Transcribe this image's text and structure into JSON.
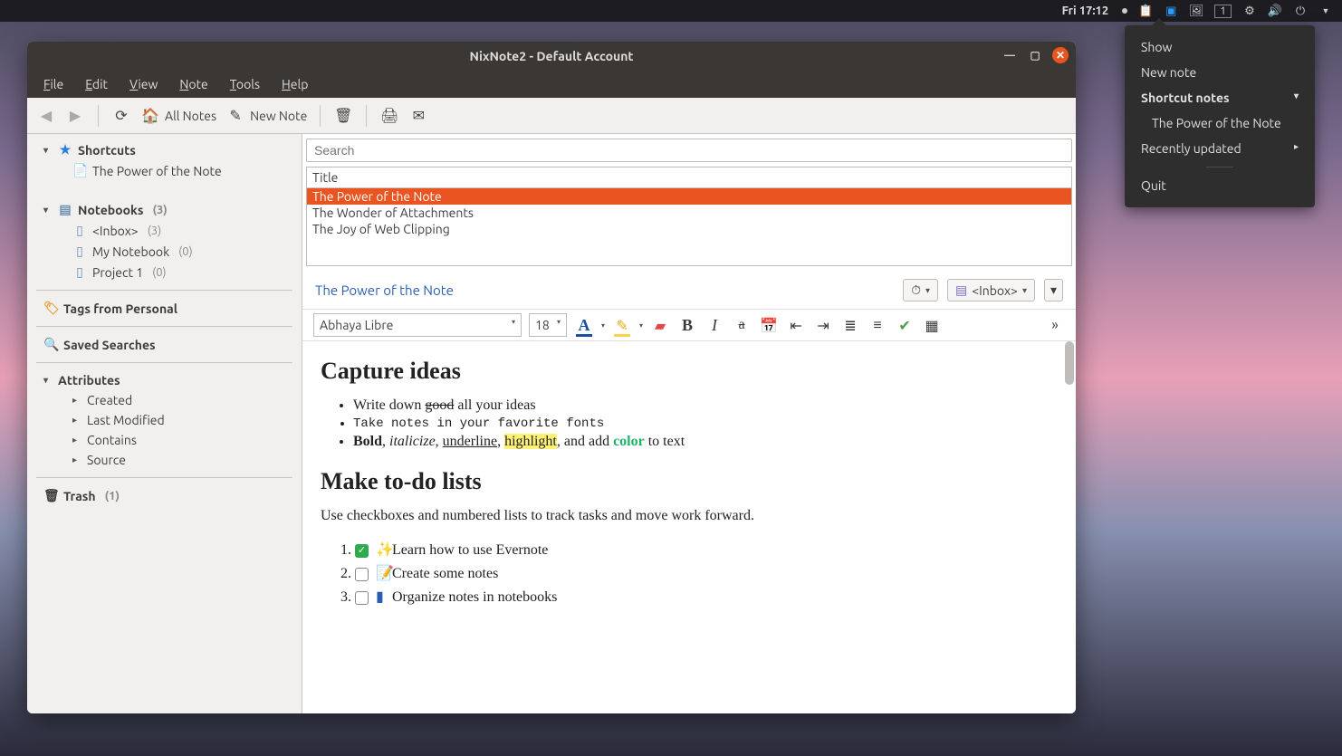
{
  "topbar": {
    "clock": "Fri 17:12",
    "workspace": "1"
  },
  "tray_menu": {
    "show": "Show",
    "new_note": "New note",
    "shortcut_notes": "Shortcut notes",
    "shortcut_link": "The Power of the Note",
    "recently_updated": "Recently updated",
    "quit": "Quit"
  },
  "window": {
    "title": "NixNote2 - Default Account"
  },
  "menubar": {
    "file": "File",
    "edit": "Edit",
    "view": "View",
    "note": "Note",
    "tools": "Tools",
    "help": "Help"
  },
  "toolbar": {
    "all_notes": "All Notes",
    "new_note": "New Note"
  },
  "sidebar": {
    "shortcuts_label": "Shortcuts",
    "shortcut1": "The Power of the Note",
    "notebooks_label": "Notebooks",
    "notebooks_count": "(3)",
    "inbox_label": "<Inbox>",
    "inbox_count": "(3)",
    "nb1_label": "My Notebook",
    "nb1_count": "(0)",
    "nb2_label": "Project 1",
    "nb2_count": "(0)",
    "tags_label": "Tags from Personal",
    "saved_searches_label": "Saved Searches",
    "attributes_label": "Attributes",
    "attr_created": "Created",
    "attr_modified": "Last Modified",
    "attr_contains": "Contains",
    "attr_source": "Source",
    "trash_label": "Trash",
    "trash_count": "(1)"
  },
  "search": {
    "placeholder": "Search"
  },
  "notelist": {
    "col_title": "Title",
    "rows": {
      "r0": "The Power of the Note",
      "r1": "The Wonder of Attachments",
      "r2": "The Joy of Web Clipping"
    }
  },
  "note_head": {
    "title": "The Power of the Note",
    "notebook": "<Inbox>"
  },
  "fmt": {
    "font": "Abhaya Libre",
    "size": "18"
  },
  "editor": {
    "h1": "Capture ideas",
    "li1_a": "Write down ",
    "li1_strike": "good",
    "li1_b": " all your ideas",
    "li2": "Take notes in your favorite fonts",
    "li3_bold": "Bold",
    "li3_s1": ", ",
    "li3_italic": "italicize",
    "li3_s2": ", ",
    "li3_ul": "underline",
    "li3_s3": ", ",
    "li3_hl": "highlight",
    "li3_s4": ", and add ",
    "li3_clr": "color",
    "li3_s5": " to text",
    "h2": "Make to-do lists",
    "p1": "Use checkboxes and numbered lists to track tasks and move work forward.",
    "ol1": "Learn how to use Evernote",
    "ol2": "Create some notes",
    "ol3": "Organize notes in notebooks"
  }
}
